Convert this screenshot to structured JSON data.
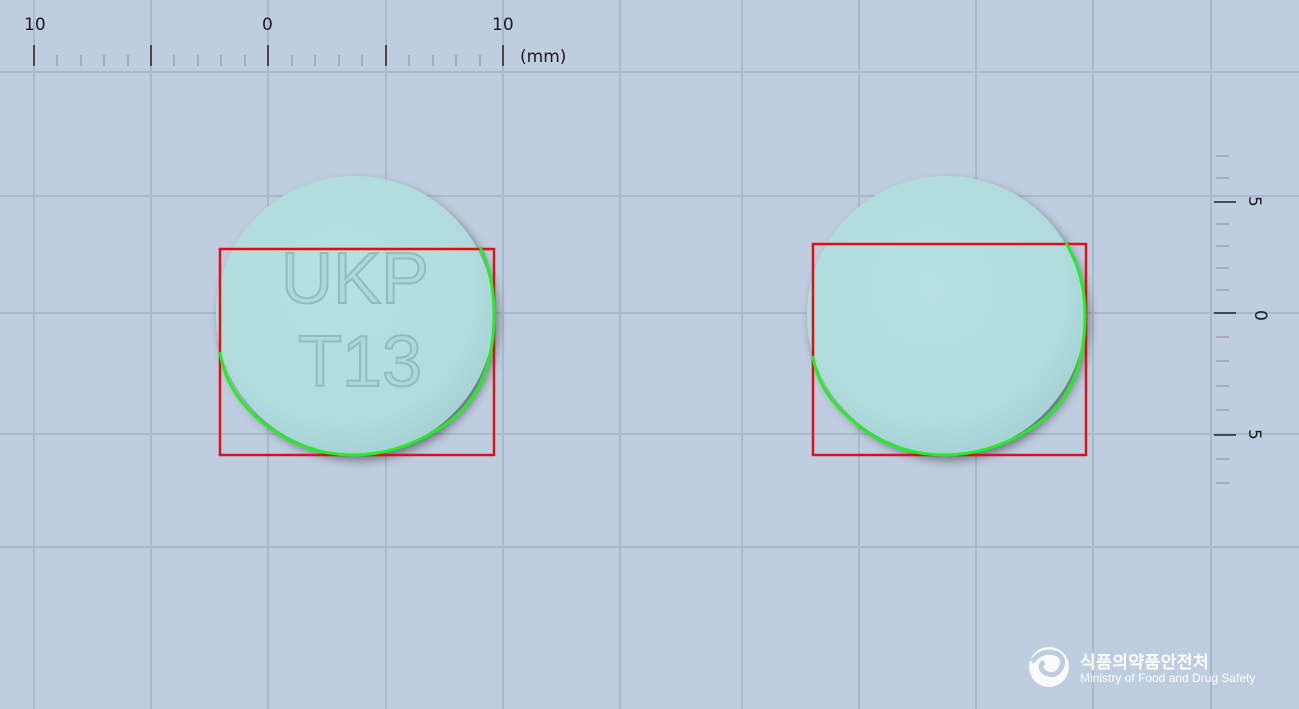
{
  "ruler_top": {
    "labels": [
      "10",
      "0",
      "10"
    ],
    "unit": "(mm)"
  },
  "ruler_right": {
    "labels": [
      "5",
      "0",
      "5"
    ]
  },
  "pill_front": {
    "imprint_line1": "UKP",
    "imprint_line2": "T13"
  },
  "pill_back": {
    "imprint": ""
  },
  "colors": {
    "background": "#bfcde0",
    "grid": "#a9b8cc",
    "pill": "#b3dfe0",
    "bbox": "#e01010",
    "contour": "#22ee22"
  },
  "logo": {
    "korean": "식품의약품안전처",
    "english": "Ministry of Food and Drug Safety"
  }
}
